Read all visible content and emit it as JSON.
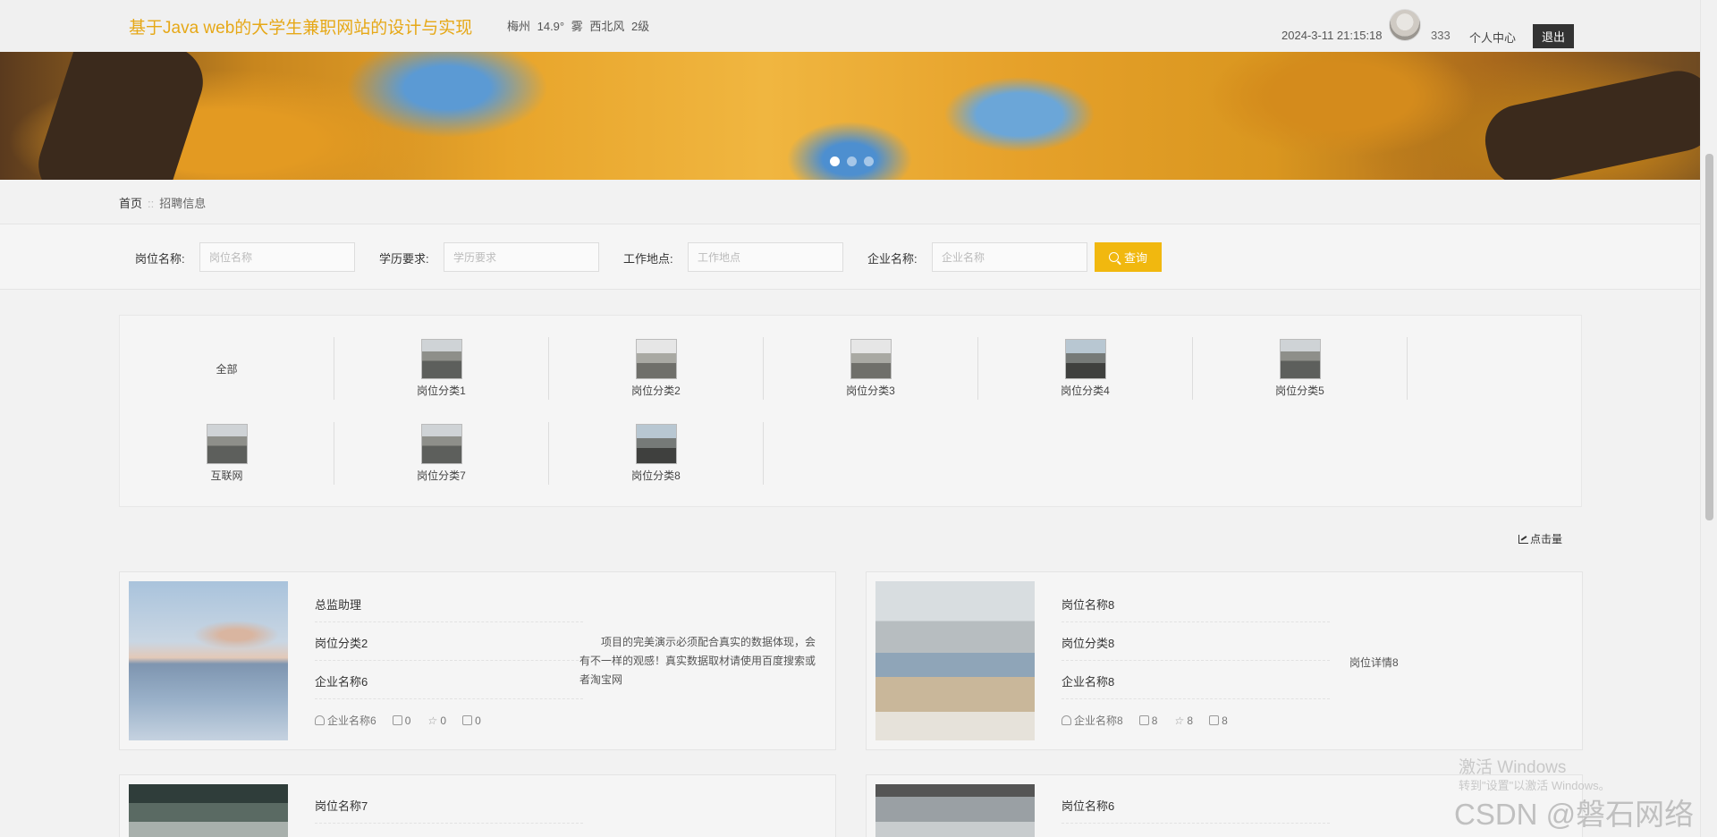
{
  "header": {
    "site_title": "基于Java web的大学生兼职网站的设计与实现",
    "weather": "梅州 14.9° 雾 西北风 2级",
    "datetime": "2024-3-11 21:15:18",
    "username": "333",
    "center_link": "个人中心",
    "logout": "退出"
  },
  "breadcrumb": {
    "home": "首页",
    "separator": "::",
    "current": "招聘信息"
  },
  "search": {
    "fields": [
      {
        "label": "岗位名称:",
        "placeholder": "岗位名称"
      },
      {
        "label": "学历要求:",
        "placeholder": "学历要求"
      },
      {
        "label": "工作地点:",
        "placeholder": "工作地点"
      },
      {
        "label": "企业名称:",
        "placeholder": "企业名称"
      }
    ],
    "button": "查询"
  },
  "categories": [
    {
      "label": "全部",
      "has_image": false
    },
    {
      "label": "岗位分类1",
      "has_image": true
    },
    {
      "label": "岗位分类2",
      "has_image": true
    },
    {
      "label": "岗位分类3",
      "has_image": true
    },
    {
      "label": "岗位分类4",
      "has_image": true
    },
    {
      "label": "岗位分类5",
      "has_image": true
    },
    {
      "label": "互联网",
      "has_image": true
    },
    {
      "label": "岗位分类7",
      "has_image": true
    },
    {
      "label": "岗位分类8",
      "has_image": true
    }
  ],
  "sort": {
    "label": "点击量"
  },
  "jobs": [
    {
      "title": "总监助理",
      "category": "岗位分类2",
      "company": "企业名称6",
      "meta_company": "企业名称6",
      "likes": "0",
      "favorites": "0",
      "comments": "0",
      "description": "项目的完美演示必须配合真实的数据体现，会有不一样的观感！真实数据取材请使用百度搜索或者淘宝网",
      "detail": ""
    },
    {
      "title": "岗位名称8",
      "category": "岗位分类8",
      "company": "企业名称8",
      "meta_company": "企业名称8",
      "likes": "8",
      "favorites": "8",
      "comments": "8",
      "description": "",
      "detail": "岗位详情8"
    },
    {
      "title": "岗位名称7"
    },
    {
      "title": "岗位名称6"
    }
  ],
  "watermark": {
    "activate": "激活 Windows",
    "activate_hint": "转到\"设置\"以激活 Windows。",
    "csdn": "CSDN @磐石网络"
  }
}
